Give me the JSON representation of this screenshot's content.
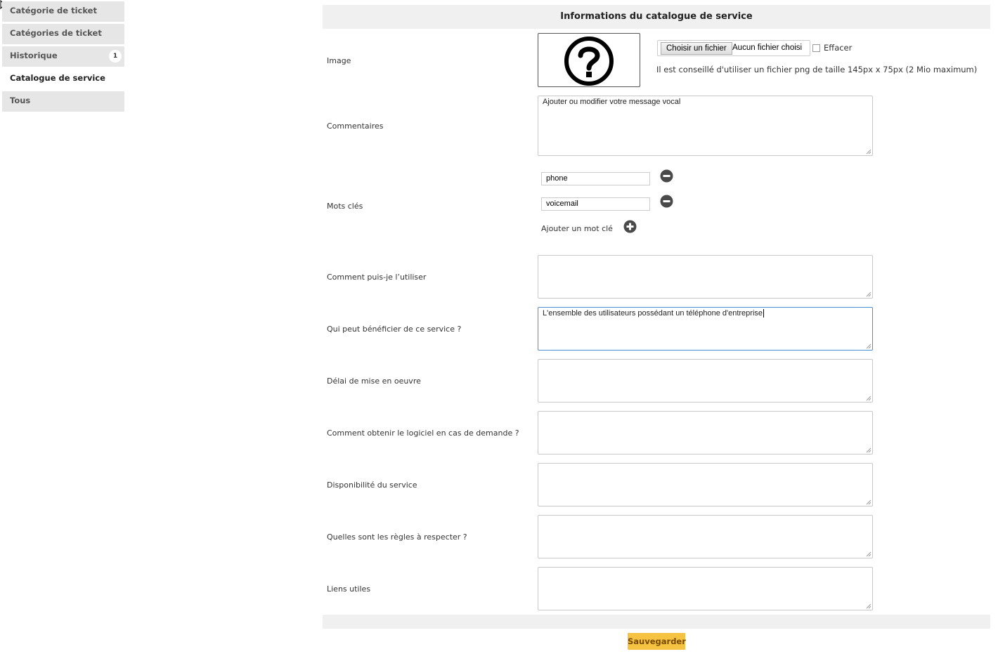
{
  "sidebar": {
    "items": [
      {
        "label": "Catégorie de ticket"
      },
      {
        "label": "Catégories de ticket"
      },
      {
        "label": "Historique",
        "badge": "1"
      },
      {
        "label": "Catalogue de service"
      },
      {
        "label": "Tous"
      }
    ]
  },
  "form": {
    "title": "Informations du catalogue de service",
    "image": {
      "label": "Image",
      "choose_button": "Choisir un fichier",
      "file_status": "Aucun fichier choisi",
      "clear_label": "Effacer",
      "hint": "Il est conseillé d'utiliser un fichier png de taille 145px x 75px (2 Mio maximum)"
    },
    "comments": {
      "label": "Commentaires",
      "value": "Ajouter ou modifier votre message vocal"
    },
    "keywords": {
      "label": "Mots clés",
      "values": [
        "phone",
        "voicemail"
      ],
      "add_label": "Ajouter un mot clé"
    },
    "how_to_use": {
      "label": "Comment puis-je l’utiliser",
      "value": ""
    },
    "who_benefits": {
      "label": "Qui peut bénéficier de ce service ?",
      "value": "L'ensemble des utilisateurs possédant un téléphone d'entreprise"
    },
    "delay": {
      "label": "Délai de mise en oeuvre",
      "value": ""
    },
    "obtain": {
      "label": "Comment obtenir le logiciel en cas de demande ?",
      "value": ""
    },
    "availability": {
      "label": "Disponibilité du service",
      "value": ""
    },
    "rules": {
      "label": "Quelles sont les règles à respecter ?",
      "value": ""
    },
    "links": {
      "label": "Liens utiles",
      "value": ""
    },
    "save_label": "Sauvegarder"
  },
  "colors": {
    "accent": "#f5c242",
    "focus": "#4a8fd6"
  },
  "icons": [
    "cursor-icon",
    "question-mark-icon",
    "remove-keyword-icon",
    "add-keyword-icon",
    "resize-grip-icon"
  ]
}
